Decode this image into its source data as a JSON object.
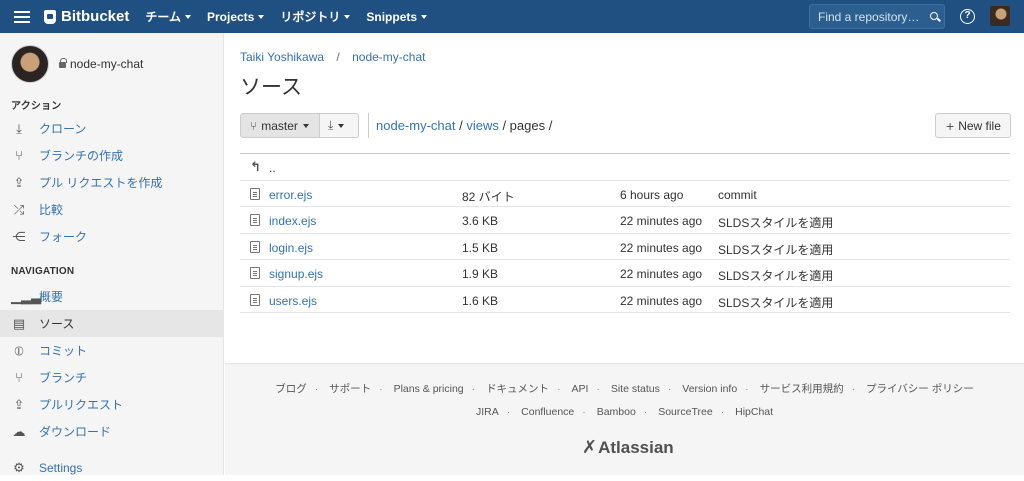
{
  "header": {
    "brand": "Bitbucket",
    "nav": [
      "チーム",
      "Projects",
      "リポジトリ",
      "Snippets"
    ],
    "search_placeholder": "Find a repository…",
    "help": "?"
  },
  "sidebar": {
    "repo_name": "node-my-chat",
    "actions_heading": "アクション",
    "actions": [
      {
        "label": "クローン",
        "icon": "clone-icon"
      },
      {
        "label": "ブランチの作成",
        "icon": "create-branch-icon"
      },
      {
        "label": "プル リクエストを作成",
        "icon": "create-pull-request-icon"
      },
      {
        "label": "比較",
        "icon": "compare-icon"
      },
      {
        "label": "フォーク",
        "icon": "fork-icon"
      }
    ],
    "navigation_heading": "NAVIGATION",
    "navigation": [
      {
        "label": "概要",
        "icon": "overview-icon"
      },
      {
        "label": "ソース",
        "icon": "source-icon",
        "active": true
      },
      {
        "label": "コミット",
        "icon": "commit-icon"
      },
      {
        "label": "ブランチ",
        "icon": "branch-icon"
      },
      {
        "label": "プルリクエスト",
        "icon": "pull-request-icon"
      },
      {
        "label": "ダウンロード",
        "icon": "download-icon"
      },
      {
        "label": "Settings",
        "icon": "settings-icon"
      }
    ]
  },
  "main": {
    "breadcrumb": [
      "Taiki Yoshikawa",
      "node-my-chat"
    ],
    "breadcrumb_sep": "/",
    "title": "ソース",
    "branch": "master",
    "path": [
      {
        "text": "node-my-chat",
        "link": true
      },
      {
        "text": " / ",
        "link": false
      },
      {
        "text": "views",
        "link": true
      },
      {
        "text": " / pages /",
        "link": false
      }
    ],
    "new_file": "New file",
    "parent_dir": "..",
    "files": [
      {
        "name": "error.ejs",
        "size": "82 バイト",
        "time": "6 hours ago",
        "message": "commit"
      },
      {
        "name": "index.ejs",
        "size": "3.6 KB",
        "time": "22 minutes ago",
        "message": "SLDSスタイルを適用"
      },
      {
        "name": "login.ejs",
        "size": "1.5 KB",
        "time": "22 minutes ago",
        "message": "SLDSスタイルを適用"
      },
      {
        "name": "signup.ejs",
        "size": "1.9 KB",
        "time": "22 minutes ago",
        "message": "SLDSスタイルを適用"
      },
      {
        "name": "users.ejs",
        "size": "1.6 KB",
        "time": "22 minutes ago",
        "message": "SLDSスタイルを適用"
      }
    ]
  },
  "footer": {
    "links1": [
      "ブログ",
      "サポート",
      "Plans & pricing",
      "ドキュメント",
      "API",
      "Site status",
      "Version info",
      "サービス利用規約",
      "プライバシー ポリシー"
    ],
    "links2": [
      "JIRA",
      "Confluence",
      "Bamboo",
      "SourceTree",
      "HipChat"
    ],
    "brand": "Atlassian"
  },
  "colors": {
    "header": "#205081",
    "link": "#3572b0",
    "sidebar": "#f5f5f5"
  }
}
